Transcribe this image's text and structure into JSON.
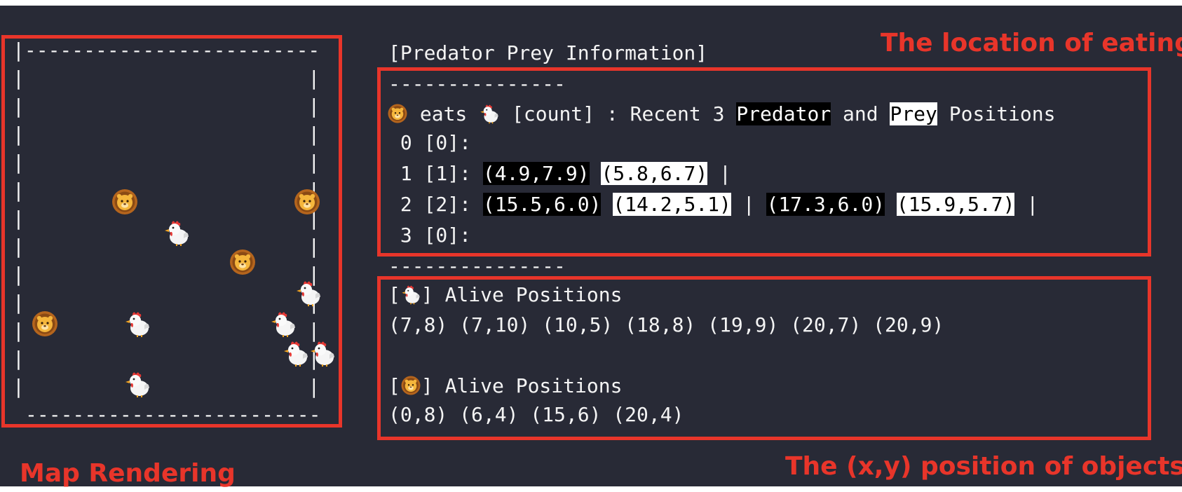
{
  "callouts": {
    "location_of_eating": "The location of eating",
    "map_rendering": "Map Rendering",
    "xy_position": "The (x,y) position of objects"
  },
  "map": {
    "top_border": "|-------------------------",
    "bottom_border": "-------------------------",
    "rows": [
      "|                        |",
      "|                        |",
      "|                        |",
      "|                        |",
      "|                        |",
      "|                        |",
      "|                        |",
      "|                        |",
      "|                        |",
      "|                        |",
      "|                        |",
      "|                        |"
    ],
    "icons": [
      "lion-icon",
      "chicken-icon"
    ]
  },
  "info": {
    "header": "[Predator Prey Information]",
    "divider": "---------------",
    "eats_word": "eats",
    "count_label": "[count] : Recent 3",
    "predator_word": "Predator",
    "and_word": "and",
    "prey_word": "Prey",
    "positions_word": "Positions",
    "records": [
      {
        "prefix": " 0 [0]:",
        "pairs": []
      },
      {
        "prefix": " 1 [1]:",
        "pairs": [
          {
            "predator": "(4.9,7.9)",
            "prey": "(5.8,6.7)"
          }
        ]
      },
      {
        "prefix": " 2 [2]:",
        "pairs": [
          {
            "predator": "(15.5,6.0)",
            "prey": "(14.2,5.1)"
          },
          {
            "predator": "(17.3,6.0)",
            "prey": "(15.9,5.7)"
          }
        ]
      },
      {
        "prefix": " 3 [0]:",
        "pairs": []
      }
    ]
  },
  "alive": {
    "prey_header_open": "[",
    "prey_header_close": "] Alive Positions",
    "prey_positions": "(7,8) (7,10) (10,5) (18,8) (19,9) (20,7) (20,9)",
    "predator_header_open": "[",
    "predator_header_close": "] Alive Positions",
    "predator_positions": "(0,8) (6,4) (15,6) (20,4)"
  },
  "colors": {
    "background": "#282a36",
    "terminal_text": "#f4f4f4",
    "annotation_red": "#e8352a"
  }
}
